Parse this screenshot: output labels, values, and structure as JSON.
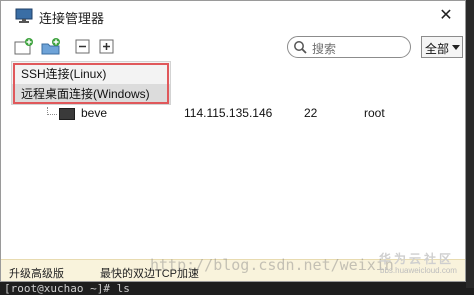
{
  "window": {
    "title": "连接管理器",
    "close_glyph": "✕"
  },
  "toolbar": {
    "buttons": [
      {
        "name": "new-connection-icon"
      },
      {
        "name": "new-folder-icon"
      },
      {
        "name": "collapse-all-icon"
      },
      {
        "name": "expand-all-icon"
      }
    ]
  },
  "search": {
    "placeholder": "搜索"
  },
  "filter": {
    "selected": "全部"
  },
  "dropdown": {
    "items": [
      "SSH连接(Linux)",
      "远程桌面连接(Windows)"
    ],
    "highlighted_index": 1
  },
  "connections": [
    {
      "name": "beve",
      "host": "114.115.135.146",
      "port": "22",
      "user": "root"
    }
  ],
  "bottombar": {
    "upgrade_label": "升级高级版",
    "promo_label": "最快的双边TCP加速"
  },
  "watermark": {
    "text": "http://blog.csdn.net/weixin",
    "brand_name": "华为云社区",
    "brand_url": "bbs.huaweicloud.com"
  },
  "terminal": {
    "line": "[root@xuchao ~]# ls"
  },
  "colors": {
    "highlight_outline": "#e0585b",
    "bottombar_bg": "#f9f3dc"
  }
}
